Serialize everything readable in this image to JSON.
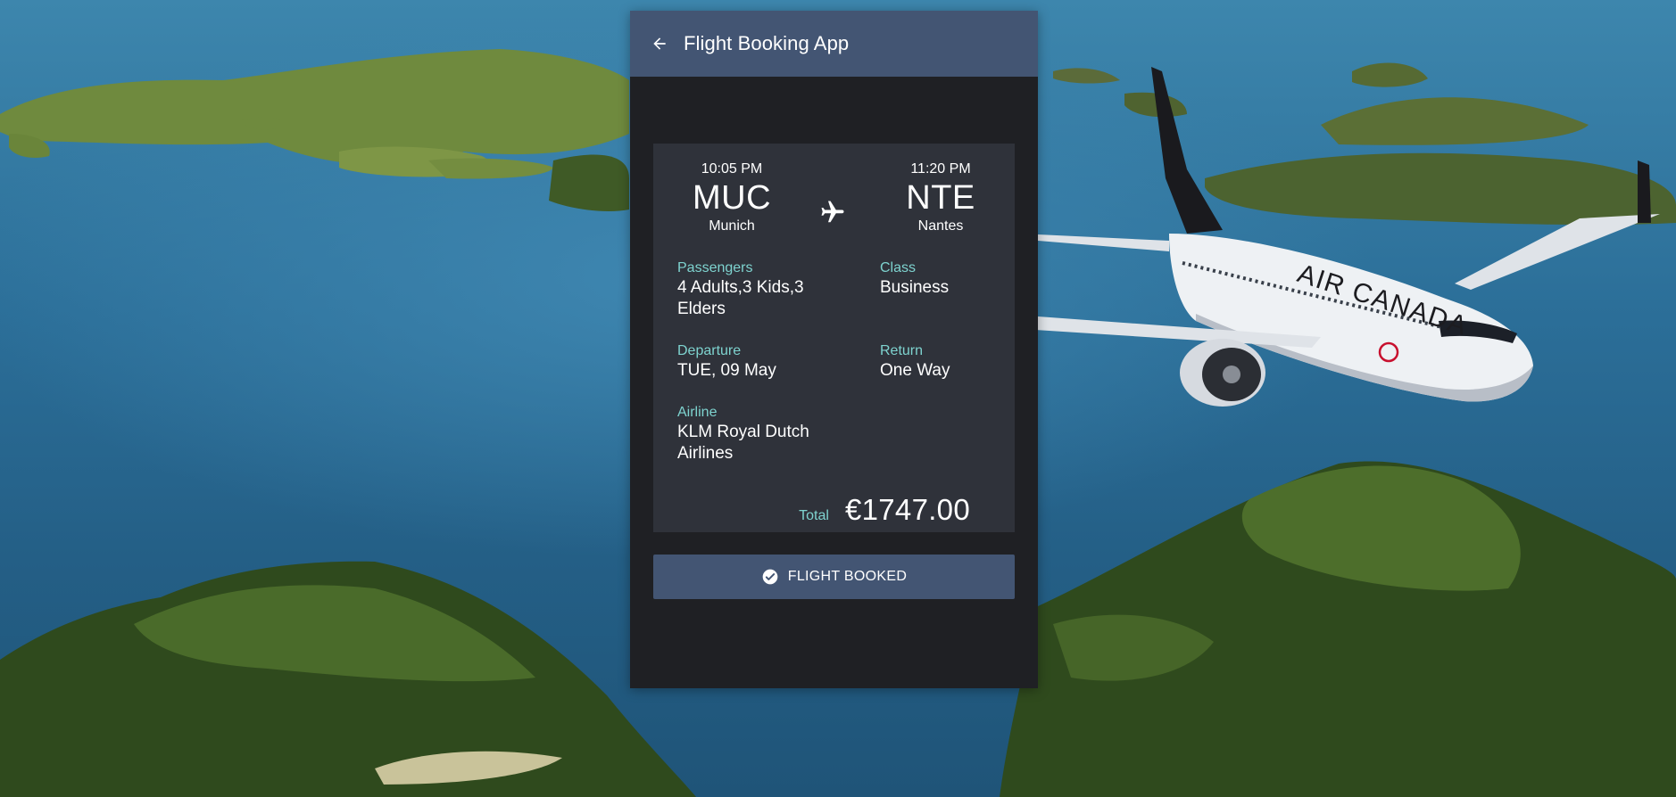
{
  "header": {
    "title": "Flight Booking App",
    "back_icon": "arrow-left-icon"
  },
  "flight": {
    "from": {
      "time": "10:05 PM",
      "code": "MUC",
      "city": "Munich"
    },
    "to": {
      "time": "11:20 PM",
      "code": "NTE",
      "city": "Nantes"
    },
    "route_icon": "airplane-icon"
  },
  "details": {
    "passengers": {
      "label": "Passengers",
      "value": "4 Adults,3 Kids,3 Elders"
    },
    "class": {
      "label": "Class",
      "value": "Business"
    },
    "departure": {
      "label": "Departure",
      "value": "TUE, 09 May"
    },
    "return": {
      "label": "Return",
      "value": "One Way"
    },
    "airline": {
      "label": "Airline",
      "value": "KLM Royal Dutch Airlines"
    }
  },
  "total": {
    "label": "Total",
    "amount": "€1747.00"
  },
  "action": {
    "label": "FLIGHT BOOKED",
    "icon": "check-circle-icon"
  },
  "background": {
    "aircraft_livery": "AIR CANADA"
  },
  "colors": {
    "appbar": "#435573",
    "panel": "#1f2024",
    "card": "#2f323a",
    "label_accent": "#7ed3cf",
    "button": "#435573"
  }
}
